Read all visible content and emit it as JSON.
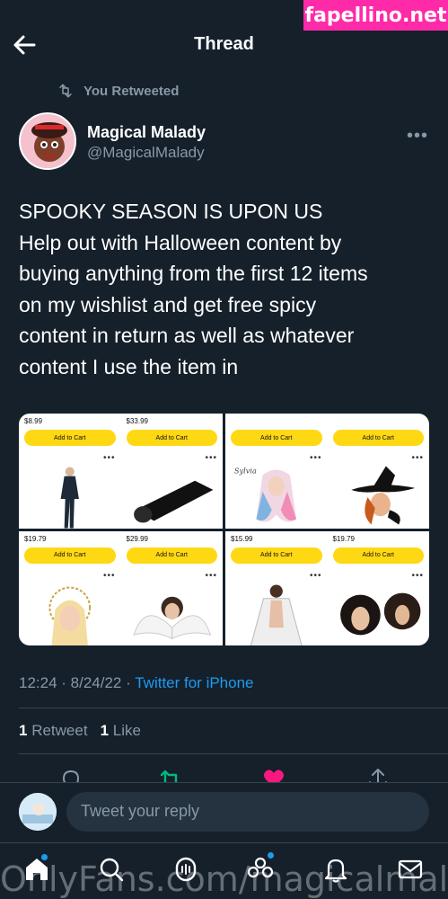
{
  "watermark_top": "fapellino.net",
  "watermark_bottom": "OnlyFans.com/magicalmalad",
  "header": {
    "title": "Thread"
  },
  "retweet_label": "You Retweeted",
  "author": {
    "name": "Magical Malady",
    "handle": "@MagicalMalady"
  },
  "tweet_lines": [
    "SPOOKY SEASON IS UPON US",
    "Help out with Halloween content by",
    "buying anything from the first 12 items",
    "on my wishlist and get free spicy",
    "content in return as well as whatever",
    "content I use the item in"
  ],
  "media": [
    {
      "products": [
        {
          "price": "$8.99",
          "button": "Add to Cart",
          "image": "bodysuit"
        },
        {
          "price": "$33.99",
          "button": "Add to Cart",
          "image": "foam-roll"
        }
      ]
    },
    {
      "products": [
        {
          "price": "",
          "button": "Add to Cart",
          "image": "pastel-wig",
          "caption": "Sylvia"
        },
        {
          "price": "",
          "button": "Add to Cart",
          "image": "witch-hat"
        }
      ]
    },
    {
      "products": [
        {
          "price": "$19.79",
          "button": "Add to Cart",
          "image": "halo-crown"
        },
        {
          "price": "$29.99",
          "button": "Add to Cart",
          "image": "angel-wings"
        }
      ]
    },
    {
      "products": [
        {
          "price": "$15.99",
          "button": "Add to Cart",
          "image": "lace-robe"
        },
        {
          "price": "$19.79",
          "button": "Add to Cart",
          "image": "curly-wig"
        }
      ]
    }
  ],
  "meta": {
    "time": "12:24",
    "date": "8/24/22",
    "source": "Twitter for iPhone"
  },
  "stats": {
    "retweets_count": "1",
    "retweets_label": "Retweet",
    "likes_count": "1",
    "likes_label": "Like"
  },
  "reply": {
    "placeholder": "Tweet your reply"
  },
  "colors": {
    "background": "#15202b",
    "accent": "#1d9bf0",
    "like": "#f91880",
    "retweet": "#00ba7c",
    "muted": "#8899a6",
    "cart_button": "#ffd814"
  }
}
